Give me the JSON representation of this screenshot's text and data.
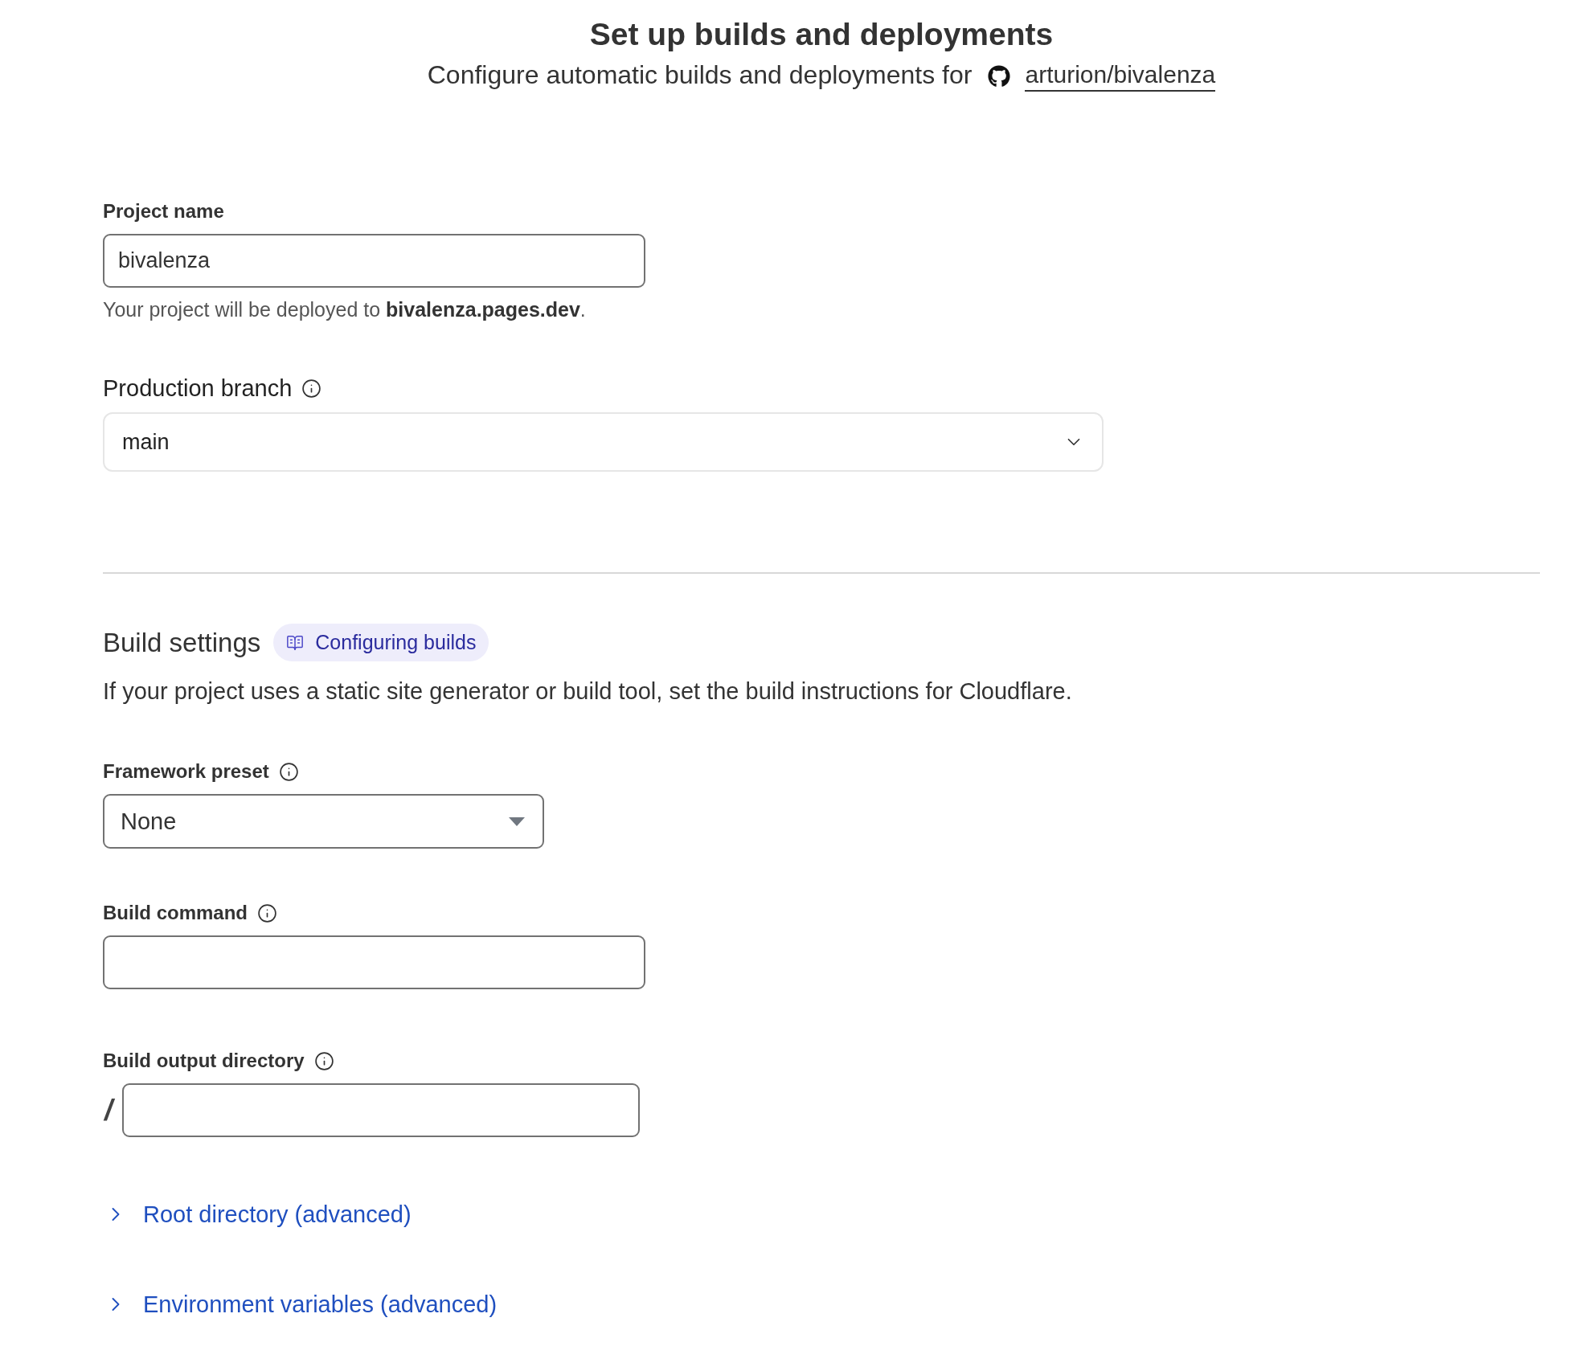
{
  "header": {
    "title": "Set up builds and deployments",
    "subtitle": "Configure automatic builds and deployments for",
    "repo_link": "arturion/bivalenza"
  },
  "project_name": {
    "label": "Project name",
    "value": "bivalenza",
    "hint": "Your project will be deployed to **bivalenza.pages.dev**."
  },
  "production_branch": {
    "label": "Production branch",
    "value": "main"
  },
  "build_settings": {
    "title": "Build settings",
    "docs_link": "Configuring builds",
    "description": "If your project uses a static site generator or build tool, set the build instructions for Cloudflare."
  },
  "fields": [
    {
      "kind": "select",
      "label": "Framework preset",
      "value": "None"
    },
    {
      "kind": "text",
      "label": "Build command"
    },
    {
      "kind": "path",
      "label": "Build output directory",
      "prefix": "/"
    }
  ],
  "advanced": [
    {
      "label": "Root directory (advanced)",
      "expanded": false
    },
    {
      "label": "Environment variables (advanced)",
      "expanded": false
    }
  ]
}
